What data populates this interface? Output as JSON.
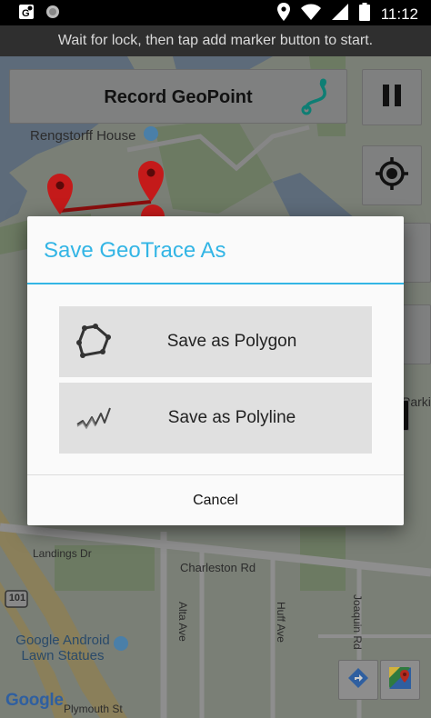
{
  "status_bar": {
    "time": "11:12",
    "icons": [
      "gps-notification-icon",
      "circle-notification-icon",
      "location-icon",
      "wifi-icon",
      "signal-icon",
      "battery-icon"
    ]
  },
  "hint": "Wait for lock, then tap add marker button to start.",
  "toolbar": {
    "record_label": "Record GeoPoint",
    "route_icon": "route-icon",
    "pause_icon": "pause-icon",
    "location_icon": "my-location-icon"
  },
  "map": {
    "labels": {
      "rengstorff": "Rengstorff House",
      "landings": "Landings Dr",
      "charleston": "Charleston Rd",
      "alta": "Alta Ave",
      "huff": "Huff Ave",
      "joaquin": "Joaquin Rd",
      "google_statues": "Google Android\nLawn Statues",
      "plymouth": "Plymouth St",
      "parki": "Parki",
      "highway": "101"
    },
    "logo": "Google",
    "colors": {
      "marker": "#c41a1a",
      "line": "#8b0d0d"
    }
  },
  "dialog": {
    "title": "Save GeoTrace As",
    "options": [
      {
        "label": "Save as Polygon",
        "icon": "polygon-icon"
      },
      {
        "label": "Save as Polyline",
        "icon": "polyline-icon"
      }
    ],
    "cancel": "Cancel",
    "accent_color": "#33b5e5"
  }
}
